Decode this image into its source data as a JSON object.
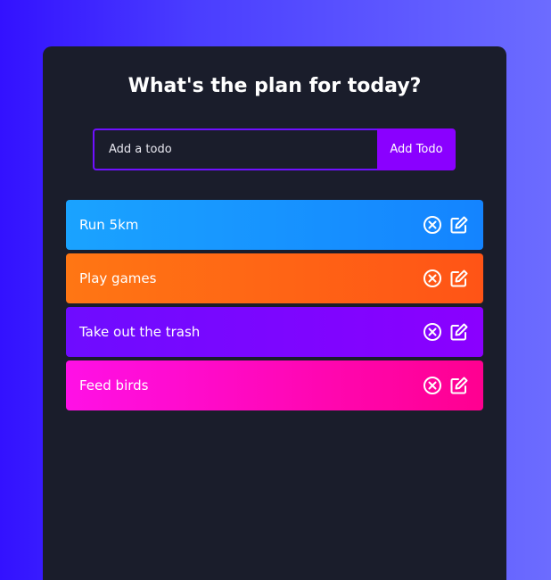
{
  "app": {
    "title": "What's the plan for today?"
  },
  "form": {
    "placeholder": "Add a todo",
    "button_label": "Add Todo"
  },
  "todos": [
    {
      "label": "Run 5km",
      "color_start": "#1aa3ff",
      "color_end": "#1484ff"
    },
    {
      "label": "Play games",
      "color_start": "#ff7614",
      "color_end": "#ff5416"
    },
    {
      "label": "Take out the trash",
      "color_start": "#6e0cff",
      "color_end": "#8a00ff"
    },
    {
      "label": "Feed birds",
      "color_start": "#ff10e6",
      "color_end": "#ff0090"
    }
  ],
  "icons": {
    "delete": "close-circle-icon",
    "edit": "edit-icon"
  },
  "colors": {
    "panel": "#1a1d2b",
    "accent": "#8a00ff",
    "input_border": "#6f10ff"
  }
}
